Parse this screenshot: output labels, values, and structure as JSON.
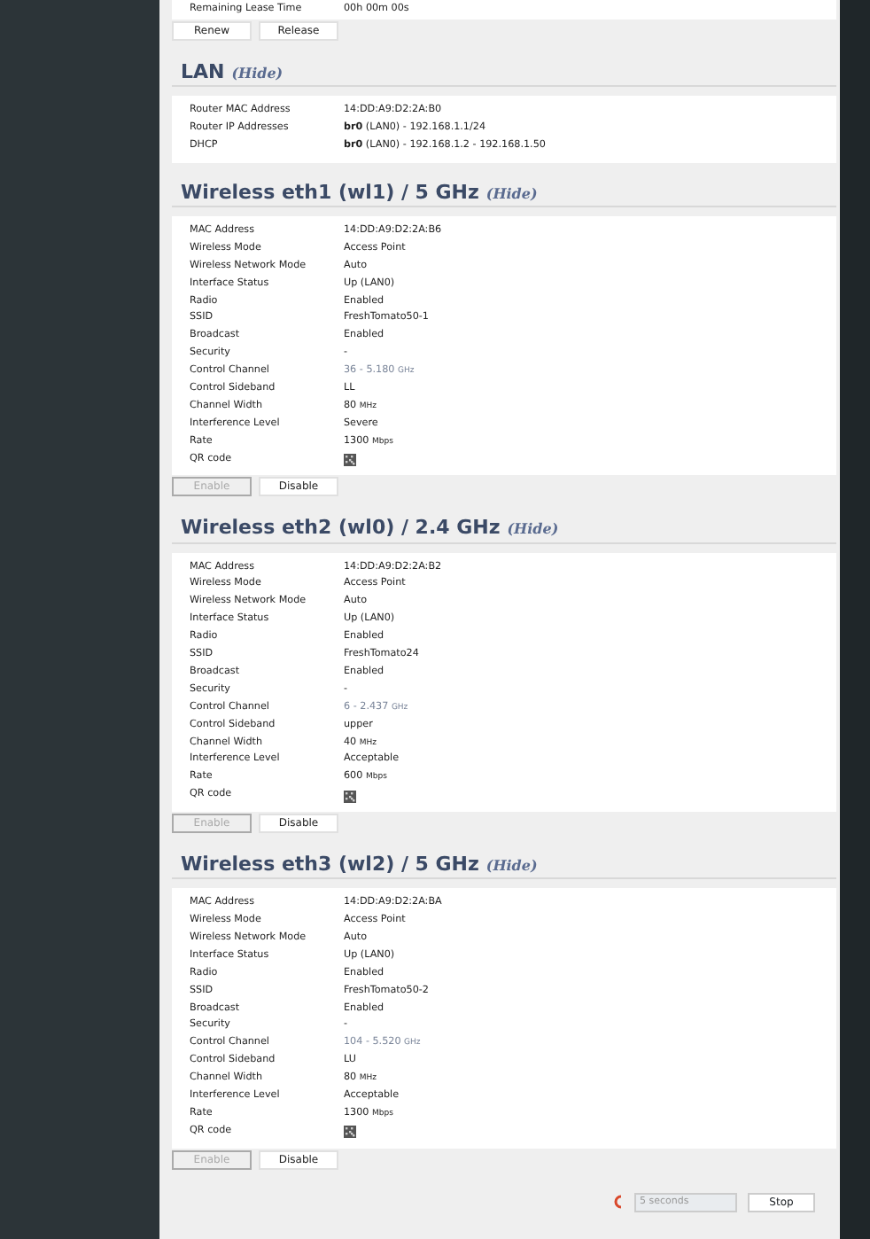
{
  "sections": [
    {
      "rows": [
        {
          "label": "Remaining Lease Time",
          "value": "00h 00m 00s"
        }
      ],
      "buttons": [
        {
          "label": "Renew",
          "disabled": false
        },
        {
          "label": "Release",
          "disabled": false
        }
      ]
    },
    {
      "title": "LAN",
      "hide": "(Hide)",
      "rows": [
        {
          "label": "Router MAC Address",
          "value": "14:DD:A9:D2:2A:B0"
        },
        {
          "label": "Router IP Addresses",
          "value": "**br0** (LAN0) - 192.168.1.1/24"
        },
        {
          "label": "DHCP",
          "value": "**br0** (LAN0) - 192.168.1.2 - 192.168.1.50"
        }
      ]
    },
    {
      "title": "Wireless eth1 (wl1) / 5 GHz",
      "hide": "(Hide)",
      "rows": [
        {
          "label": "MAC Address",
          "value": "14:DD:A9:D2:2A:B6"
        },
        {
          "label": "Wireless Mode",
          "value": "Access Point"
        },
        {
          "label": "Wireless Network Mode",
          "value": "Auto"
        },
        {
          "label": "Interface Status",
          "value": "Up (LAN0)"
        },
        {
          "label": "Radio",
          "value": "Enabled"
        },
        {
          "label": "SSID",
          "value": "FreshTomato50-1"
        },
        {
          "label": "Broadcast",
          "value": "Enabled"
        },
        {
          "label": "Security",
          "value": "-"
        },
        {
          "label": "Control Channel",
          "value": "36 - 5.180",
          "unit": "GHz",
          "kind": "muted"
        },
        {
          "label": "Control Sideband",
          "value": "LL"
        },
        {
          "label": "Channel Width",
          "value": "80",
          "unit": "MHz"
        },
        {
          "label": "Interference Level",
          "value": "Severe"
        },
        {
          "label": "Rate",
          "value": "1300",
          "unit": "Mbps"
        },
        {
          "label": "QR code",
          "kind": "qr"
        }
      ],
      "buttons": [
        {
          "label": "Enable",
          "disabled": true
        },
        {
          "label": "Disable",
          "disabled": false
        }
      ]
    },
    {
      "title": "Wireless eth2 (wl0) / 2.4 GHz",
      "hide": "(Hide)",
      "rows": [
        {
          "label": "MAC Address",
          "value": "14:DD:A9:D2:2A:B2"
        },
        {
          "label": "Wireless Mode",
          "value": "Access Point"
        },
        {
          "label": "Wireless Network Mode",
          "value": "Auto"
        },
        {
          "label": "Interface Status",
          "value": "Up (LAN0)"
        },
        {
          "label": "Radio",
          "value": "Enabled"
        },
        {
          "label": "SSID",
          "value": "FreshTomato24"
        },
        {
          "label": "Broadcast",
          "value": "Enabled"
        },
        {
          "label": "Security",
          "value": "-"
        },
        {
          "label": "Control Channel",
          "value": "6 - 2.437",
          "unit": "GHz",
          "kind": "muted"
        },
        {
          "label": "Control Sideband",
          "value": "upper"
        },
        {
          "label": "Channel Width",
          "value": "40",
          "unit": "MHz"
        },
        {
          "label": "Interference Level",
          "value": "Acceptable"
        },
        {
          "label": "Rate",
          "value": "600",
          "unit": "Mbps"
        },
        {
          "label": "QR code",
          "kind": "qr"
        }
      ],
      "buttons": [
        {
          "label": "Enable",
          "disabled": true
        },
        {
          "label": "Disable",
          "disabled": false
        }
      ]
    },
    {
      "title": "Wireless eth3 (wl2) / 5 GHz",
      "hide": "(Hide)",
      "rows": [
        {
          "label": "MAC Address",
          "value": "14:DD:A9:D2:2A:BA"
        },
        {
          "label": "Wireless Mode",
          "value": "Access Point"
        },
        {
          "label": "Wireless Network Mode",
          "value": "Auto"
        },
        {
          "label": "Interface Status",
          "value": "Up (LAN0)"
        },
        {
          "label": "Radio",
          "value": "Enabled"
        },
        {
          "label": "SSID",
          "value": "FreshTomato50-2"
        },
        {
          "label": "Broadcast",
          "value": "Enabled"
        },
        {
          "label": "Security",
          "value": "-"
        },
        {
          "label": "Control Channel",
          "value": "104 - 5.520",
          "unit": "GHz",
          "kind": "muted"
        },
        {
          "label": "Control Sideband",
          "value": "LU"
        },
        {
          "label": "Channel Width",
          "value": "80",
          "unit": "MHz"
        },
        {
          "label": "Interference Level",
          "value": "Acceptable"
        },
        {
          "label": "Rate",
          "value": "1300",
          "unit": "Mbps"
        },
        {
          "label": "QR code",
          "kind": "qr"
        }
      ],
      "buttons": [
        {
          "label": "Enable",
          "disabled": true
        },
        {
          "label": "Disable",
          "disabled": false
        }
      ]
    }
  ],
  "refresh": {
    "interval": "5 seconds",
    "interval_disabled": true,
    "button": "Stop"
  }
}
